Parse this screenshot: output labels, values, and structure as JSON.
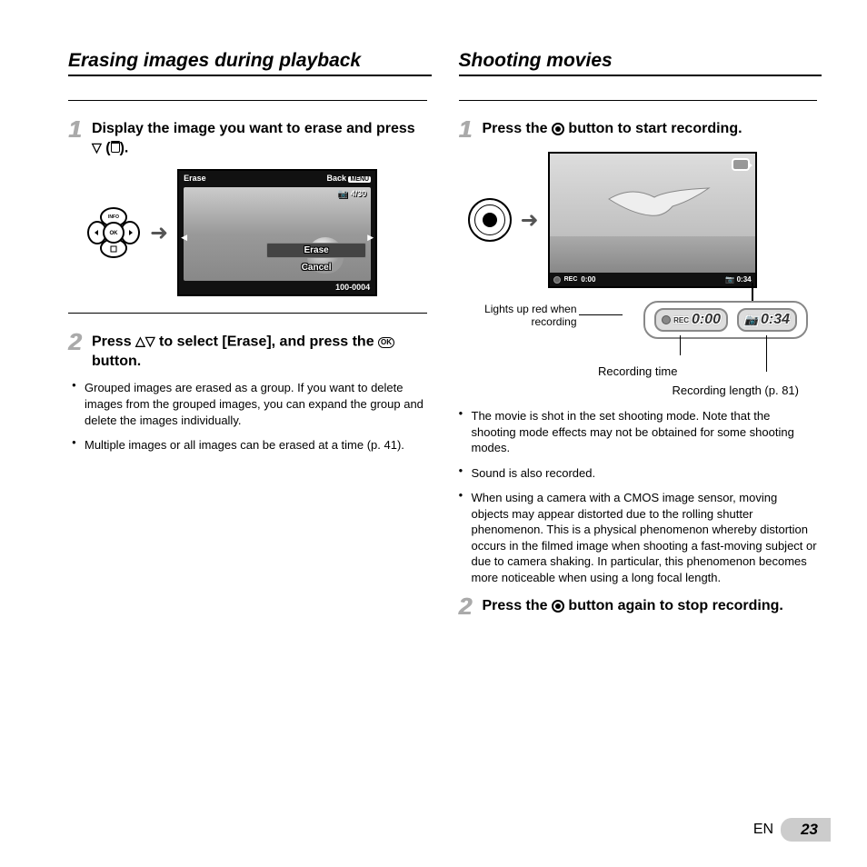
{
  "left": {
    "heading": "Erasing images during playback",
    "step1_num": "1",
    "step1_text_a": "Display the image you want to erase and press ",
    "step1_text_b": " (",
    "step1_text_c": ").",
    "screen": {
      "title": "Erase",
      "back": "Back",
      "menu": "MENU",
      "counter": "4/30",
      "opt_erase": "Erase",
      "opt_cancel": "Cancel",
      "folio": "100-0004"
    },
    "dpad": {
      "top": "INFO",
      "ok": "OK"
    },
    "step2_num": "2",
    "step2_text_a": "Press ",
    "step2_text_b": " to select [Erase], and press the ",
    "step2_text_c": " button.",
    "ok_label": "OK",
    "bullets": [
      "Grouped images are erased as a group. If you want to delete images from the grouped images, you can expand the group and delete the images individually.",
      "Multiple images or all images can be erased at a time (p. 41)."
    ]
  },
  "right": {
    "heading": "Shooting movies",
    "step1_num": "1",
    "step1_text_a": "Press the ",
    "step1_text_b": " button to start recording.",
    "screen": {
      "rec": "REC",
      "time": "0:00",
      "len_small": "0:34"
    },
    "bubble": {
      "rec": "REC",
      "time": "0:00",
      "len": "0:34"
    },
    "call_lights": "Lights up red when recording",
    "call_rectime": "Recording time",
    "call_reclen": "Recording length (p. 81)",
    "bullets": [
      "The movie is shot in the set shooting mode. Note that the shooting mode effects may not be obtained for some shooting modes.",
      "Sound is also recorded.",
      "When using a camera with a CMOS image sensor, moving objects may appear distorted due to the rolling shutter phenomenon. This is a physical phenomenon whereby distortion occurs in the filmed image when shooting a fast-moving subject or due to camera shaking. In particular, this phenomenon becomes more noticeable when using a long focal length."
    ],
    "step2_num": "2",
    "step2_text_a": "Press the ",
    "step2_text_b": " button again to stop recording."
  },
  "footer": {
    "lang": "EN",
    "page": "23"
  }
}
